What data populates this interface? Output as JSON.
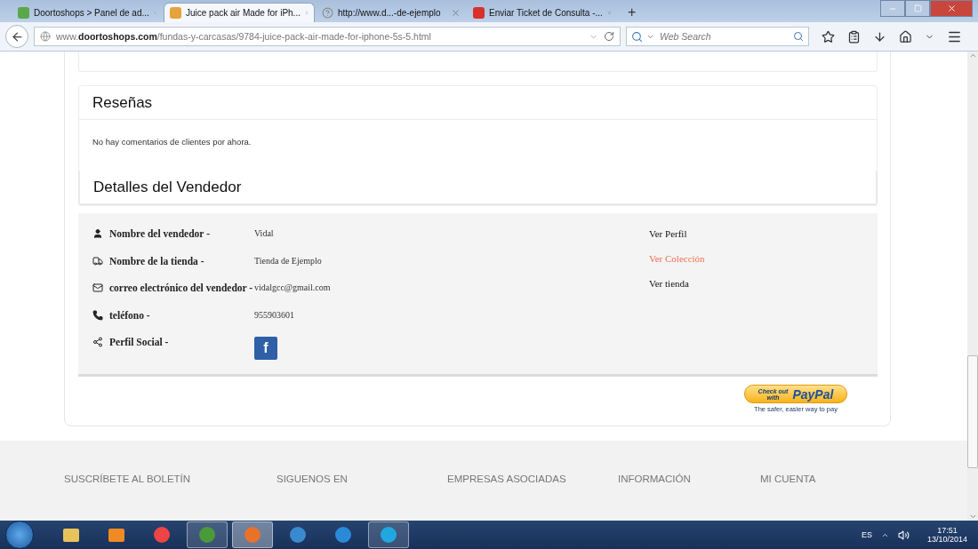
{
  "browser": {
    "tabs": [
      {
        "title": "Doortoshops > Panel de ad...",
        "selected": false
      },
      {
        "title": "Juice pack air Made for iPh...",
        "selected": true
      },
      {
        "title": "http://www.d...-de-ejemplo",
        "selected": false
      },
      {
        "title": "Enviar Ticket de Consulta -...",
        "selected": false
      }
    ],
    "new_tab": "+",
    "url": "www.**doortoshops.com**/fundas-y-carcasas/9784-juice-pack-air-made-for-iphone-5s-5.html",
    "search": {
      "placeholder": "Web Search"
    }
  },
  "reviews": {
    "title": "Reseñas",
    "text": "No hay comentarios de clientes por ahora."
  },
  "seller": {
    "title": "Detalles del Vendedor",
    "rows": [
      {
        "label": "Nombre del vendedor -",
        "kind": "text",
        "value": "Vidal"
      },
      {
        "label": "Nombre de la tienda -",
        "kind": "text",
        "value": "Tienda de Ejemplo"
      },
      {
        "label": "correo electrónico del vendedor -",
        "kind": "text",
        "value": "vidalgcc@gmail.com"
      },
      {
        "label": "teléfono -",
        "kind": "text",
        "value": "955903601"
      },
      {
        "label": "Perfil Social -",
        "kind": "facebook",
        "value": "f"
      }
    ],
    "links": [
      {
        "label": "Ver Perfil",
        "highlighted": false
      },
      {
        "label": "Ver Colección",
        "highlighted": true
      },
      {
        "label": "Ver tienda",
        "highlighted": false
      }
    ]
  },
  "paypal": {
    "check_out": "Check out",
    "with": "with",
    "brand": "PayPal",
    "tagline": "The safer, easier way to pay"
  },
  "footer": {
    "headings": [
      "SUSCRÍBETE AL BOLETÍN",
      "SIGUENOS EN",
      "EMPRESAS ASOCIADAS",
      "INFORMACIÓN",
      "MI CUENTA"
    ]
  },
  "taskbar": {
    "apps": [
      {
        "kind": "folder",
        "running": false,
        "selected": false
      },
      {
        "kind": "media",
        "running": false,
        "selected": false
      },
      {
        "kind": "camera",
        "running": false,
        "selected": false
      },
      {
        "kind": "chrome",
        "running": true,
        "selected": false
      },
      {
        "kind": "firefox",
        "running": true,
        "selected": true
      },
      {
        "kind": "safari",
        "running": false,
        "selected": false
      },
      {
        "kind": "ie",
        "running": false,
        "selected": false
      },
      {
        "kind": "skype",
        "running": true,
        "selected": false
      }
    ],
    "language": "ES",
    "time": "17:51",
    "date": "13/10/2014"
  }
}
